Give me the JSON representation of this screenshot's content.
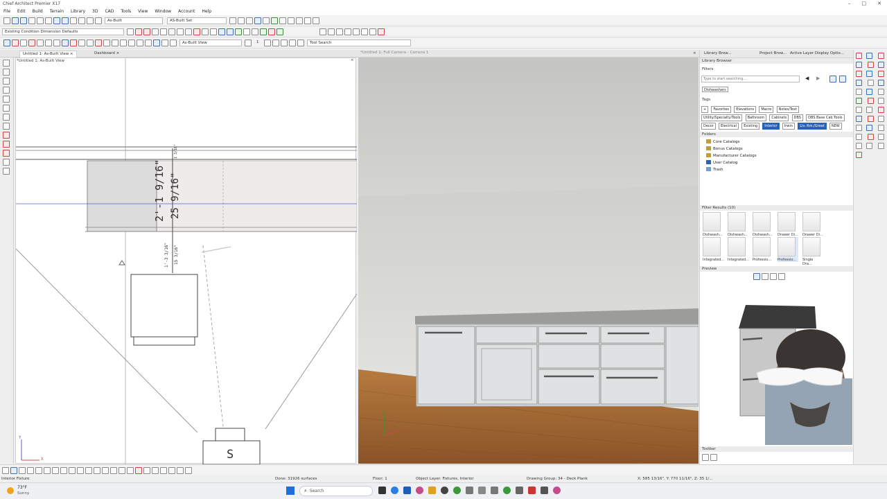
{
  "app": {
    "title": "Chief Architect Premier X17",
    "win_min": "–",
    "win_max": "□",
    "win_close": "✕"
  },
  "menu": [
    "File",
    "Edit",
    "Build",
    "Terrain",
    "Library",
    "3D",
    "CAD",
    "Tools",
    "View",
    "Window",
    "Account",
    "Help"
  ],
  "toolbar": {
    "layer_set": "As-Built",
    "as_built_set": "AS-Built Set",
    "dimension_defaults": "Existing Condition Dimension Defaults",
    "view_select": "As-Built View",
    "tool_search": "Tool Search",
    "level_value": "1"
  },
  "tabs": {
    "plan_tab": "Untitled 1: As-Built View",
    "dashboard_tab": "Dashboard",
    "plan_view_title": "*Untitled 1: As-Built View",
    "camera_view_title": "*Untitled 1: Full Camera - Camera 1",
    "close": "×"
  },
  "plan": {
    "dim_large_1": "2'-1 9/16\"",
    "dim_large_2": "25 9/16\"",
    "dim_small_1": "1'-3 3/16\"",
    "dim_small_2": "15 3/16\"",
    "dim_top": "1 3/16\"",
    "appliance_letter": "S",
    "axis_y": "Y",
    "axis_x": "X"
  },
  "camera": {
    "axis_z": "Z"
  },
  "right_panel": {
    "tabs": [
      "Library Brow...",
      "Project Brow...",
      "Active Layer Display Optio..."
    ],
    "header": "Library Browser",
    "filters_label": "Filters",
    "search_placeholder": "Type to start searching...",
    "active_filter": "Dishwashers",
    "tags_label": "Tags",
    "tags_row1": [
      "Favorites",
      "Elevations",
      "Macro",
      "Notes/Text"
    ],
    "tags_row2": [
      "Utility/Specialty/Tools",
      "Bathroom",
      "Cabinets",
      "DBS",
      "DBS Base Cab Tools"
    ],
    "tags_row3": [
      "Decor",
      "Electrical",
      "Existing",
      "Interior",
      "Irwin",
      "Liv. Rm./Great",
      "NEW"
    ],
    "folders_label": "Folders",
    "folders": [
      "Core Catalogs",
      "Bonus Catalogs",
      "Manufacturer Catalogs",
      "User Catalog",
      "Trash"
    ],
    "filter_results_label": "Filter Results (10)",
    "results_row1": [
      "Dishwash...",
      "Dishwash...",
      "Dishwash...",
      "Drawer Di...",
      "Drawer Di..."
    ],
    "results_row2": [
      "Integrated...",
      "Integrated...",
      "Professio...",
      "Professio...",
      "Single Dra..."
    ],
    "preview_label": "Preview",
    "toolbar_label": "Toolbar"
  },
  "status": {
    "left": "Interior Fixture",
    "done": "Done: 31926 surfaces",
    "floor": "Floor: 1",
    "layer": "Object Layer: Fixtures, Interior",
    "drawing_group": "Drawing Group: 34 - Deck Plank",
    "coords": "X: 585 13/16\", Y: 770 11/16\", Z: 35 1/..."
  },
  "taskbar": {
    "weather_temp": "73°F",
    "weather_desc": "Sunny",
    "search": "Search"
  }
}
